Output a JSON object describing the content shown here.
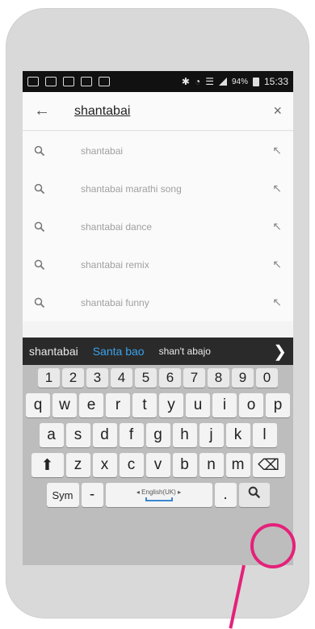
{
  "status_bar": {
    "left_icons": [
      "notification-icon",
      "mail-icon",
      "facebook-icon",
      "image-icon",
      "app-icon"
    ],
    "battery": "94%",
    "time": "15:33"
  },
  "search": {
    "query": "shantabai",
    "back_icon": "back-arrow-icon",
    "clear_icon": "close-icon"
  },
  "suggestions": [
    {
      "text": "shantabai"
    },
    {
      "text": "shantabai marathi song"
    },
    {
      "text": "shantabai dance"
    },
    {
      "text": "shantabai remix"
    },
    {
      "text": "shantabai funny"
    }
  ],
  "prediction_bar": {
    "words": [
      "shantabai",
      "Santa bao",
      "shan't abajo"
    ],
    "more_icon": "chevron-right-icon"
  },
  "keyboard": {
    "numbers": [
      "1",
      "2",
      "3",
      "4",
      "5",
      "6",
      "7",
      "8",
      "9",
      "0"
    ],
    "row1": [
      "q",
      "w",
      "e",
      "r",
      "t",
      "y",
      "u",
      "i",
      "o",
      "p"
    ],
    "row2": [
      "a",
      "s",
      "d",
      "f",
      "g",
      "h",
      "j",
      "k",
      "l"
    ],
    "row3": [
      "z",
      "x",
      "c",
      "v",
      "b",
      "n",
      "m"
    ],
    "sym_label": "Sym",
    "dash_label": "-",
    "space_label": "◂ English(UK) ▸",
    "period_label": "."
  },
  "colors": {
    "highlight": "#e5217a",
    "prediction_accent": "#3ba2ea"
  }
}
